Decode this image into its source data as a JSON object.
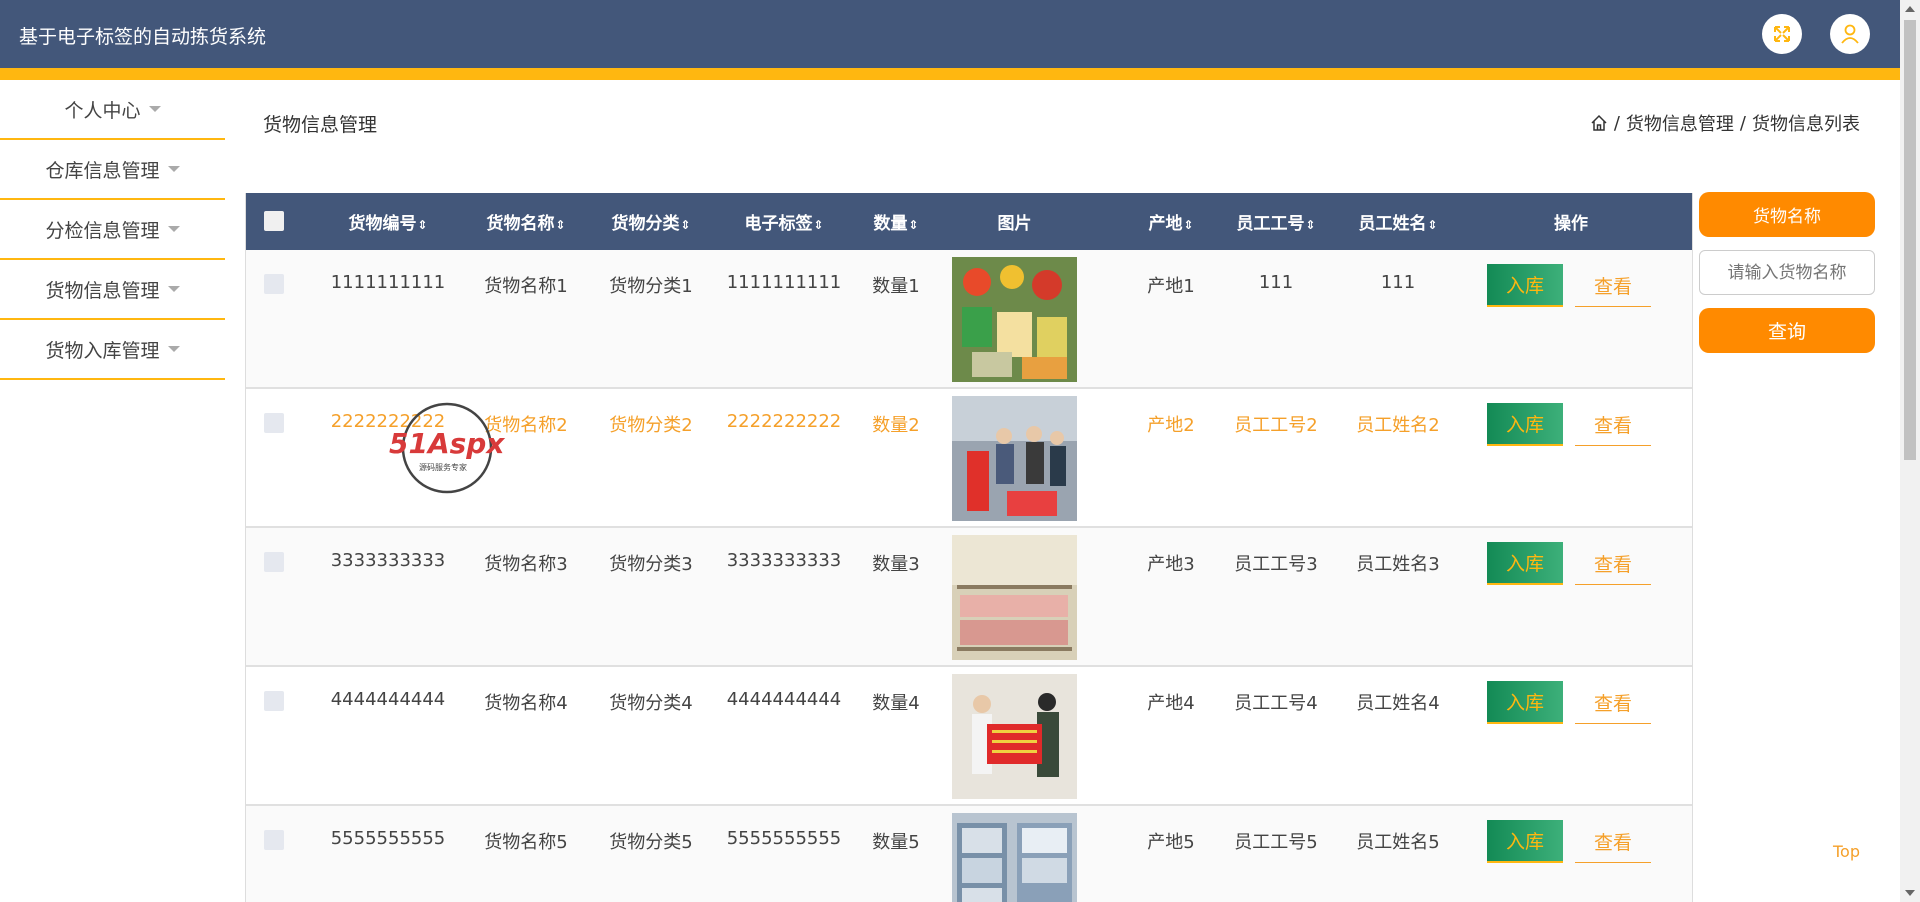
{
  "header": {
    "title": "基于电子标签的自动拣货系统",
    "fullscreen_icon": "expand-icon",
    "user_icon": "user-icon"
  },
  "sidebar": {
    "items": [
      {
        "label": "个人中心"
      },
      {
        "label": "仓库信息管理"
      },
      {
        "label": "分检信息管理"
      },
      {
        "label": "货物信息管理"
      },
      {
        "label": "货物入库管理"
      }
    ]
  },
  "page": {
    "title": "货物信息管理",
    "breadcrumb": [
      "货物信息管理",
      "货物信息列表"
    ],
    "breadcrumb_sep": "/"
  },
  "table": {
    "headers": {
      "code": "货物编号",
      "name": "货物名称",
      "category": "货物分类",
      "tag": "电子标签",
      "qty": "数量",
      "image": "图片",
      "origin": "产地",
      "emp_id": "员工工号",
      "emp_name": "员工姓名",
      "ops": "操作"
    },
    "sort_glyph": "⇕",
    "rows": [
      {
        "code": "1111111111",
        "name": "货物名称1",
        "category": "货物分类1",
        "tag": "1111111111",
        "qty": "数量1",
        "origin": "产地1",
        "emp_id": "111",
        "emp_name": "111"
      },
      {
        "code": "2222222222",
        "name": "货物名称2",
        "category": "货物分类2",
        "tag": "2222222222",
        "qty": "数量2",
        "origin": "产地2",
        "emp_id": "员工工号2",
        "emp_name": "员工姓名2"
      },
      {
        "code": "3333333333",
        "name": "货物名称3",
        "category": "货物分类3",
        "tag": "3333333333",
        "qty": "数量3",
        "origin": "产地3",
        "emp_id": "员工工号3",
        "emp_name": "员工姓名3"
      },
      {
        "code": "4444444444",
        "name": "货物名称4",
        "category": "货物分类4",
        "tag": "4444444444",
        "qty": "数量4",
        "origin": "产地4",
        "emp_id": "员工工号4",
        "emp_name": "员工姓名4"
      },
      {
        "code": "5555555555",
        "name": "货物名称5",
        "category": "货物分类5",
        "tag": "5555555555",
        "qty": "数量5",
        "origin": "产地5",
        "emp_id": "员工工号5",
        "emp_name": "员工姓名5"
      }
    ],
    "btn_in": "入库",
    "btn_view": "查看"
  },
  "search": {
    "label": "货物名称",
    "placeholder": "请输入货物名称",
    "button": "查询"
  },
  "watermark": {
    "brand": "51Aspx",
    "tagline": "源码服务专家"
  },
  "top_link": "Top",
  "colors": {
    "header": "#43577a",
    "accent": "#ffb710",
    "orange": "#ff8a00",
    "green": "#138a55"
  }
}
